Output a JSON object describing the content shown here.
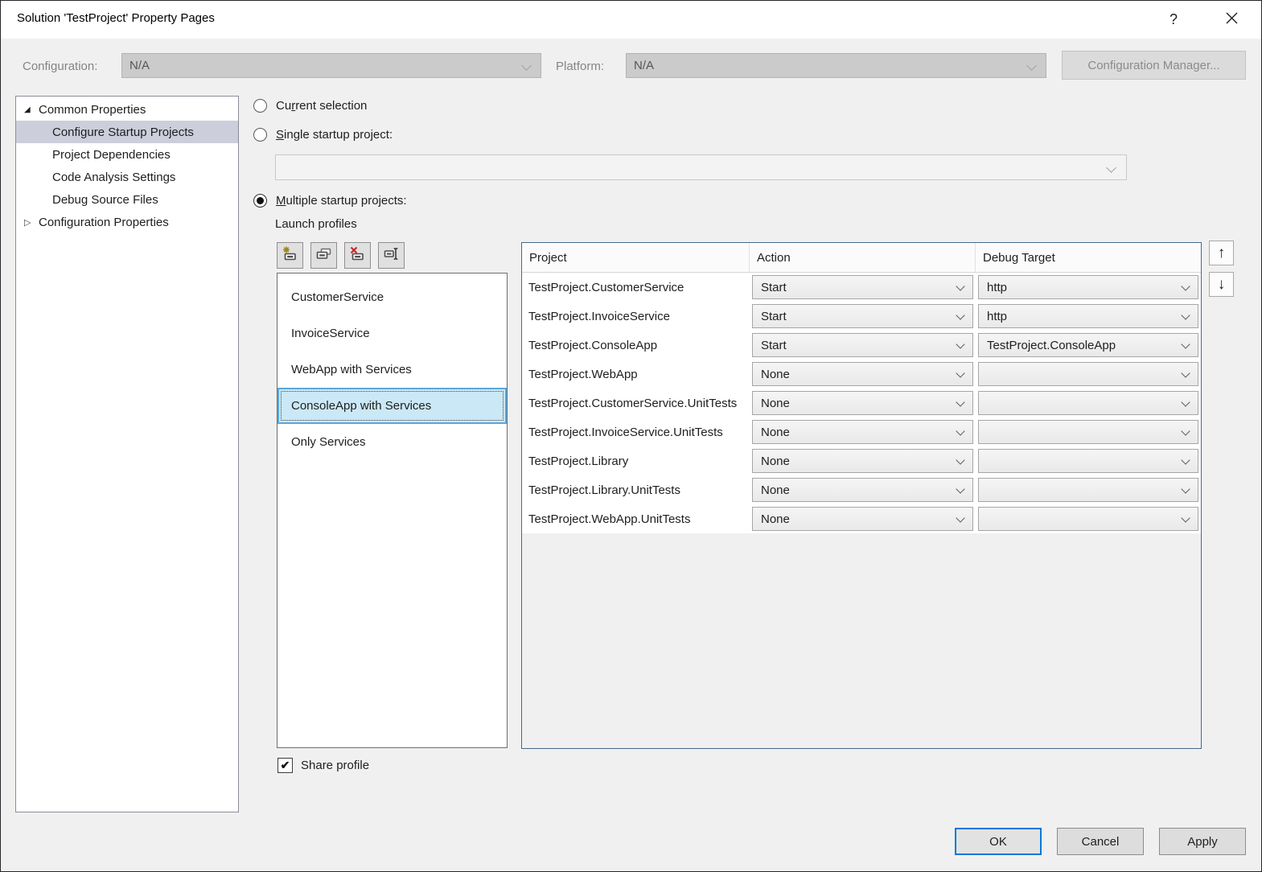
{
  "window": {
    "title": "Solution 'TestProject' Property Pages",
    "help_glyph": "?",
    "icons": [
      "help-icon",
      "close-icon"
    ]
  },
  "config_bar": {
    "configuration_label": "Configuration:",
    "configuration_value": "N/A",
    "platform_label": "Platform:",
    "platform_value": "N/A",
    "configuration_manager_label": "Configuration Manager..."
  },
  "tree": {
    "expanded_glyph": "◢",
    "collapsed_glyph": "▷",
    "items": [
      {
        "label": "Common Properties",
        "level": 0,
        "state": "expanded",
        "selected": false
      },
      {
        "label": "Configure Startup Projects",
        "level": 1,
        "state": "none",
        "selected": true
      },
      {
        "label": "Project Dependencies",
        "level": 1,
        "state": "none",
        "selected": false
      },
      {
        "label": "Code Analysis Settings",
        "level": 1,
        "state": "none",
        "selected": false
      },
      {
        "label": "Debug Source Files",
        "level": 1,
        "state": "none",
        "selected": false
      },
      {
        "label": "Configuration Properties",
        "level": 0,
        "state": "collapsed",
        "selected": false
      }
    ]
  },
  "startup": {
    "current": {
      "pre": "Cu",
      "key": "r",
      "post": "rent selection"
    },
    "single": {
      "pre": "",
      "key": "S",
      "post": "ingle startup project:"
    },
    "single_combobox_value": "",
    "multiple": {
      "pre": "",
      "key": "M",
      "post": "ultiple startup projects:"
    },
    "selected_option": "multiple"
  },
  "launch_profiles": {
    "heading": "Launch profiles",
    "toolbar_buttons": [
      "new-profile",
      "duplicate-profile",
      "delete-profile",
      "rename-profile"
    ],
    "profiles": [
      "CustomerService",
      "InvoiceService",
      "WebApp with Services",
      "ConsoleApp with Services",
      "Only Services"
    ],
    "selected_profile": "ConsoleApp with Services",
    "share_profile_label": "Share profile",
    "share_profile_checked": true,
    "check_glyph": "✔"
  },
  "projects_table": {
    "columns": [
      "Project",
      "Action",
      "Debug Target"
    ],
    "rows": [
      {
        "project": "TestProject.CustomerService",
        "action": "Start",
        "debug_target": "http"
      },
      {
        "project": "TestProject.InvoiceService",
        "action": "Start",
        "debug_target": "http"
      },
      {
        "project": "TestProject.ConsoleApp",
        "action": "Start",
        "debug_target": "TestProject.ConsoleApp"
      },
      {
        "project": "TestProject.WebApp",
        "action": "None",
        "debug_target": ""
      },
      {
        "project": "TestProject.CustomerService.UnitTests",
        "action": "None",
        "debug_target": ""
      },
      {
        "project": "TestProject.InvoiceService.UnitTests",
        "action": "None",
        "debug_target": ""
      },
      {
        "project": "TestProject.Library",
        "action": "None",
        "debug_target": ""
      },
      {
        "project": "TestProject.Library.UnitTests",
        "action": "None",
        "debug_target": ""
      },
      {
        "project": "TestProject.WebApp.UnitTests",
        "action": "None",
        "debug_target": ""
      }
    ],
    "move_up_glyph": "↑",
    "move_down_glyph": "↓"
  },
  "footer": {
    "ok_label": "OK",
    "cancel_label": "Cancel",
    "apply_label": "Apply"
  },
  "colors": {
    "dialog_bg": "#F0F0F0",
    "selection_blue_fill": "#CBE8F6",
    "selection_blue_border": "#58A8DC",
    "tree_selection": "#CCCEDB",
    "table_border": "#47698C",
    "ok_focus_border": "#0078D7"
  }
}
